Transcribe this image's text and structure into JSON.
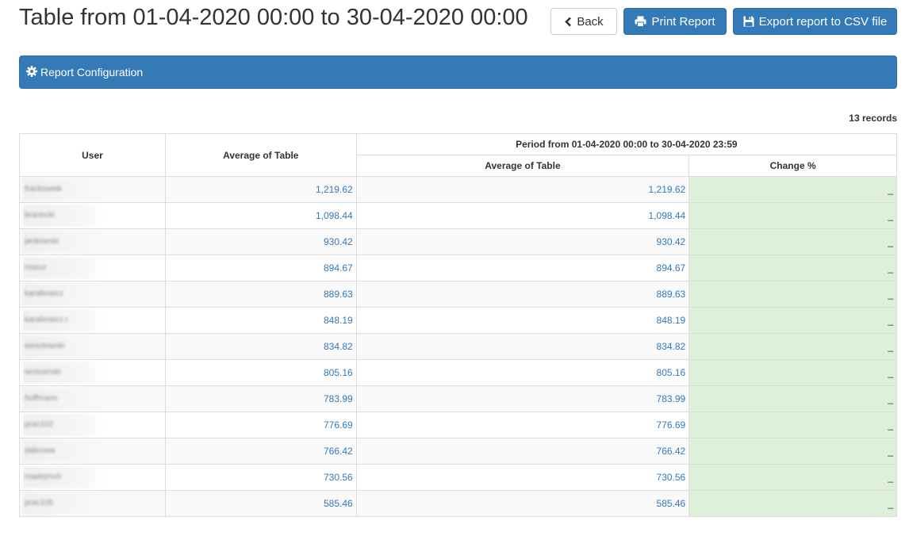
{
  "page": {
    "title": "Table from 01-04-2020 00:00 to 30-04-2020 00:00"
  },
  "toolbar": {
    "back_label": "Back",
    "print_label": "Print Report",
    "export_label": "Export report to CSV file",
    "primary_color": "#337ab7"
  },
  "config": {
    "label": "Report Configuration"
  },
  "records": {
    "count_label": "13 records"
  },
  "table": {
    "headers": {
      "user": "User",
      "average": "Average of Table",
      "period": "Period from 01-04-2020 00:00 to 30-04-2020 23:59",
      "period_average": "Average of Table",
      "change": "Change %"
    },
    "rows": [
      {
        "user": "frackowiak",
        "average": "1,219.62",
        "period_average": "1,219.62",
        "change": "_"
      },
      {
        "user": "branecki",
        "average": "1,098.44",
        "period_average": "1,098.44",
        "change": "_"
      },
      {
        "user": "jankowski",
        "average": "930.42",
        "period_average": "930.42",
        "change": "_"
      },
      {
        "user": "mazur",
        "average": "894.67",
        "period_average": "894.67",
        "change": "_"
      },
      {
        "user": "karaliewicz",
        "average": "889.63",
        "period_average": "889.63",
        "change": "_"
      },
      {
        "user": "karaliewicz.r",
        "average": "848.19",
        "period_average": "848.19",
        "change": "_"
      },
      {
        "user": "wesolowski",
        "average": "834.82",
        "period_average": "834.82",
        "change": "_"
      },
      {
        "user": "wrzesinski",
        "average": "805.16",
        "period_average": "805.16",
        "change": "_"
      },
      {
        "user": "hoffmann",
        "average": "783.99",
        "period_average": "783.99",
        "change": "_"
      },
      {
        "user": "prac102",
        "average": "776.69",
        "period_average": "776.69",
        "change": "_"
      },
      {
        "user": "dabrowa",
        "average": "766.42",
        "period_average": "766.42",
        "change": "_"
      },
      {
        "user": "madejmoh",
        "average": "730.56",
        "period_average": "730.56",
        "change": "_"
      },
      {
        "user": "prac105",
        "average": "585.46",
        "period_average": "585.46",
        "change": "_"
      }
    ]
  }
}
